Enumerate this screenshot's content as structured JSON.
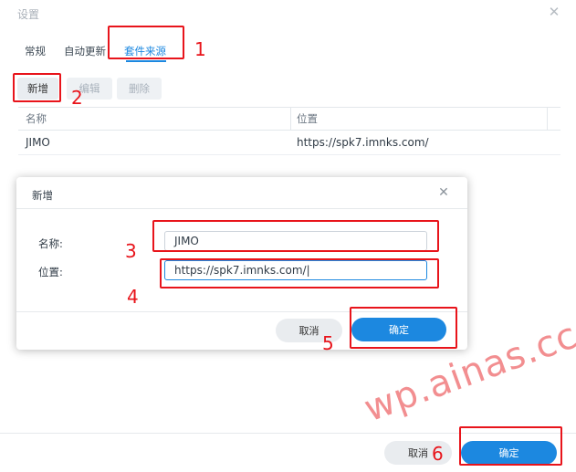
{
  "window": {
    "title": "设置",
    "close_icon": "close-icon"
  },
  "tabs": [
    {
      "label": "常规",
      "active": false
    },
    {
      "label": "自动更新",
      "active": false
    },
    {
      "label": "套件来源",
      "active": true
    }
  ],
  "toolbar": {
    "add_label": "新增",
    "edit_label": "编辑",
    "delete_label": "删除"
  },
  "table": {
    "columns": [
      "名称",
      "位置"
    ],
    "rows": [
      {
        "name": "JIMO",
        "location": "https://spk7.imnks.com/"
      }
    ]
  },
  "dialog": {
    "title": "新增",
    "close_icon": "close-icon",
    "name_label": "名称:",
    "name_value": "JIMO",
    "location_label": "位置:",
    "location_value": "https://spk7.imnks.com/",
    "cancel_label": "取消",
    "ok_label": "确定"
  },
  "footer": {
    "cancel_label": "取消",
    "ok_label": "确定"
  },
  "annotations": {
    "steps": [
      "1",
      "2",
      "3",
      "4",
      "5",
      "6"
    ],
    "color": "#e8141b"
  },
  "watermark": "wp.ainas.cc",
  "colors": {
    "accent": "#1c88e0",
    "annotation_red": "#e8141b"
  }
}
